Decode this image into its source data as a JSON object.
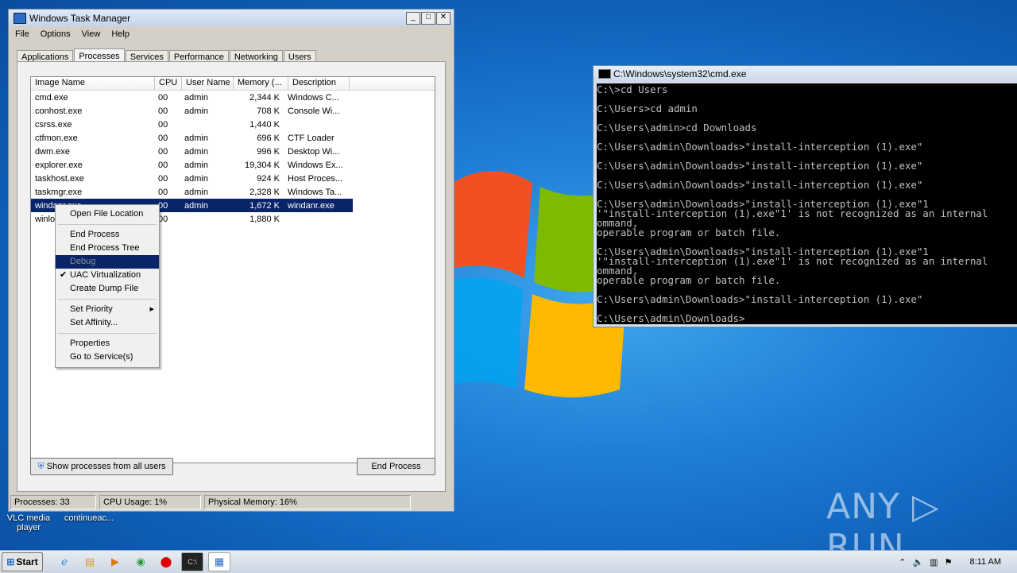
{
  "task_manager": {
    "title": "Windows Task Manager",
    "menu": [
      "File",
      "Options",
      "View",
      "Help"
    ],
    "tabs": [
      "Applications",
      "Processes",
      "Services",
      "Performance",
      "Networking",
      "Users"
    ],
    "columns": [
      "Image Name",
      "CPU",
      "User Name",
      "Memory (...",
      "Description"
    ],
    "rows": [
      {
        "name": "cmd.exe",
        "cpu": "00",
        "user": "admin",
        "mem": "2,344 K",
        "desc": "Windows C..."
      },
      {
        "name": "conhost.exe",
        "cpu": "00",
        "user": "admin",
        "mem": "708 K",
        "desc": "Console Wi..."
      },
      {
        "name": "csrss.exe",
        "cpu": "00",
        "user": "",
        "mem": "1,440 K",
        "desc": ""
      },
      {
        "name": "ctfmon.exe",
        "cpu": "00",
        "user": "admin",
        "mem": "696 K",
        "desc": "CTF Loader"
      },
      {
        "name": "dwm.exe",
        "cpu": "00",
        "user": "admin",
        "mem": "996 K",
        "desc": "Desktop Wi..."
      },
      {
        "name": "explorer.exe",
        "cpu": "00",
        "user": "admin",
        "mem": "19,304 K",
        "desc": "Windows Ex..."
      },
      {
        "name": "taskhost.exe",
        "cpu": "00",
        "user": "admin",
        "mem": "924 K",
        "desc": "Host Proces..."
      },
      {
        "name": "taskmgr.exe",
        "cpu": "00",
        "user": "admin",
        "mem": "2,328 K",
        "desc": "Windows Ta..."
      },
      {
        "name": "windanr.exe",
        "cpu": "00",
        "user": "admin",
        "mem": "1,672 K",
        "desc": "windanr.exe"
      },
      {
        "name": "winlo",
        "cpu": "00",
        "user": "",
        "mem": "1,880 K",
        "desc": ""
      }
    ],
    "show_all_label": "Show processes from all users",
    "end_process_label": "End Process",
    "status": {
      "processes": "Processes: 33",
      "cpu": "CPU Usage: 1%",
      "memory": "Physical Memory: 16%"
    }
  },
  "context_menu": {
    "items_group1": [
      "Open File Location"
    ],
    "items_group2": [
      "End Process",
      "End Process Tree",
      "Debug",
      "UAC Virtualization",
      "Create Dump File"
    ],
    "items_group3": [
      "Set Priority",
      "Set Affinity..."
    ],
    "items_group4": [
      "Properties",
      "Go to Service(s)"
    ]
  },
  "cmd": {
    "title": "C:\\Windows\\system32\\cmd.exe",
    "output": "C:\\>cd Users\n\nC:\\Users>cd admin\n\nC:\\Users\\admin>cd Downloads\n\nC:\\Users\\admin\\Downloads>\"install-interception (1).exe\"\n\nC:\\Users\\admin\\Downloads>\"install-interception (1).exe\"\n\nC:\\Users\\admin\\Downloads>\"install-interception (1).exe\"\n\nC:\\Users\\admin\\Downloads>\"install-interception (1).exe\"1\n'\"install-interception (1).exe\"1' is not recognized as an internal\nommand,\noperable program or batch file.\n\nC:\\Users\\admin\\Downloads>\"install-interception (1).exe\"1\n'\"install-interception (1).exe\"1' is not recognized as an internal\nommand,\noperable program or batch file.\n\nC:\\Users\\admin\\Downloads>\"install-interception (1).exe\"\n\nC:\\Users\\admin\\Downloads>"
  },
  "desktop": {
    "icon1": "VLC media\nplayer",
    "icon2": "continueac...",
    "watermark": "ANY ▷ RUN"
  },
  "taskbar": {
    "start": "Start",
    "clock": "8:11 AM",
    "icons": [
      "ie-icon",
      "explorer-icon",
      "media-icon",
      "chrome-icon",
      "opera-icon",
      "cmd-icon",
      "taskmgr-icon"
    ]
  }
}
